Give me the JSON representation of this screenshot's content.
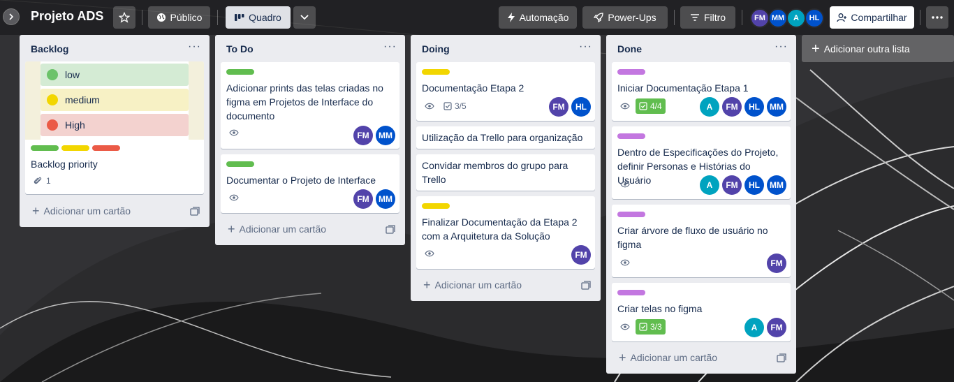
{
  "header": {
    "board_title": "Projeto ADS",
    "visibility_label": "Público",
    "view_label": "Quadro",
    "automation_label": "Automação",
    "powerups_label": "Power-Ups",
    "filter_label": "Filtro",
    "share_label": "Compartilhar",
    "members": [
      {
        "initials": "FM",
        "color": "#5243aa"
      },
      {
        "initials": "MM",
        "color": "#0052cc"
      },
      {
        "initials": "A",
        "color": "#00a3bf"
      },
      {
        "initials": "HL",
        "color": "#0052cc"
      }
    ]
  },
  "colors": {
    "avatar_fm": "#5243aa",
    "avatar_mm": "#0052cc",
    "avatar_hl": "#0052cc",
    "avatar_a": "#00a3bf",
    "label_green": "#61bd4f",
    "label_yellow": "#f2d600",
    "label_red": "#eb5a46",
    "label_purple": "#c377e0"
  },
  "add_card_label": "Adicionar um cartão",
  "add_list_label": "Adicionar outra lista",
  "lists": [
    {
      "title": "Backlog",
      "cards": [
        {
          "title": "Backlog priority",
          "cover_items": [
            "low",
            "medium",
            "High"
          ],
          "attachments": "1"
        }
      ]
    },
    {
      "title": "To Do",
      "cards": [
        {
          "title": "Adicionar prints das telas criadas no figma em Projetos de Interface do documento",
          "members": [
            "FM",
            "MM"
          ]
        },
        {
          "title": "Documentar o Projeto de Interface",
          "members": [
            "FM",
            "MM"
          ]
        }
      ]
    },
    {
      "title": "Doing",
      "cards": [
        {
          "title": "Documentação Etapa 2",
          "checklist": "3/5",
          "members": [
            "FM",
            "HL"
          ]
        },
        {
          "title": "Utilização da Trello para organização"
        },
        {
          "title": "Convidar membros do grupo para Trello"
        },
        {
          "title": "Finalizar Documentação da Etapa 2 com a Arquitetura da Solução",
          "members": [
            "FM"
          ]
        }
      ]
    },
    {
      "title": "Done",
      "cards": [
        {
          "title": "Iniciar Documentação Etapa 1",
          "checklist": "4/4",
          "members": [
            "A",
            "FM",
            "HL",
            "MM"
          ]
        },
        {
          "title": "Dentro de Especificações do Projeto, definir Personas e Histórias do Usuário",
          "members": [
            "A",
            "FM",
            "HL",
            "MM"
          ]
        },
        {
          "title": "Criar árvore de fluxo de usuário no figma",
          "members": [
            "FM"
          ]
        },
        {
          "title": "Criar telas no figma",
          "checklist": "3/3",
          "members": [
            "A",
            "FM"
          ]
        }
      ]
    }
  ]
}
